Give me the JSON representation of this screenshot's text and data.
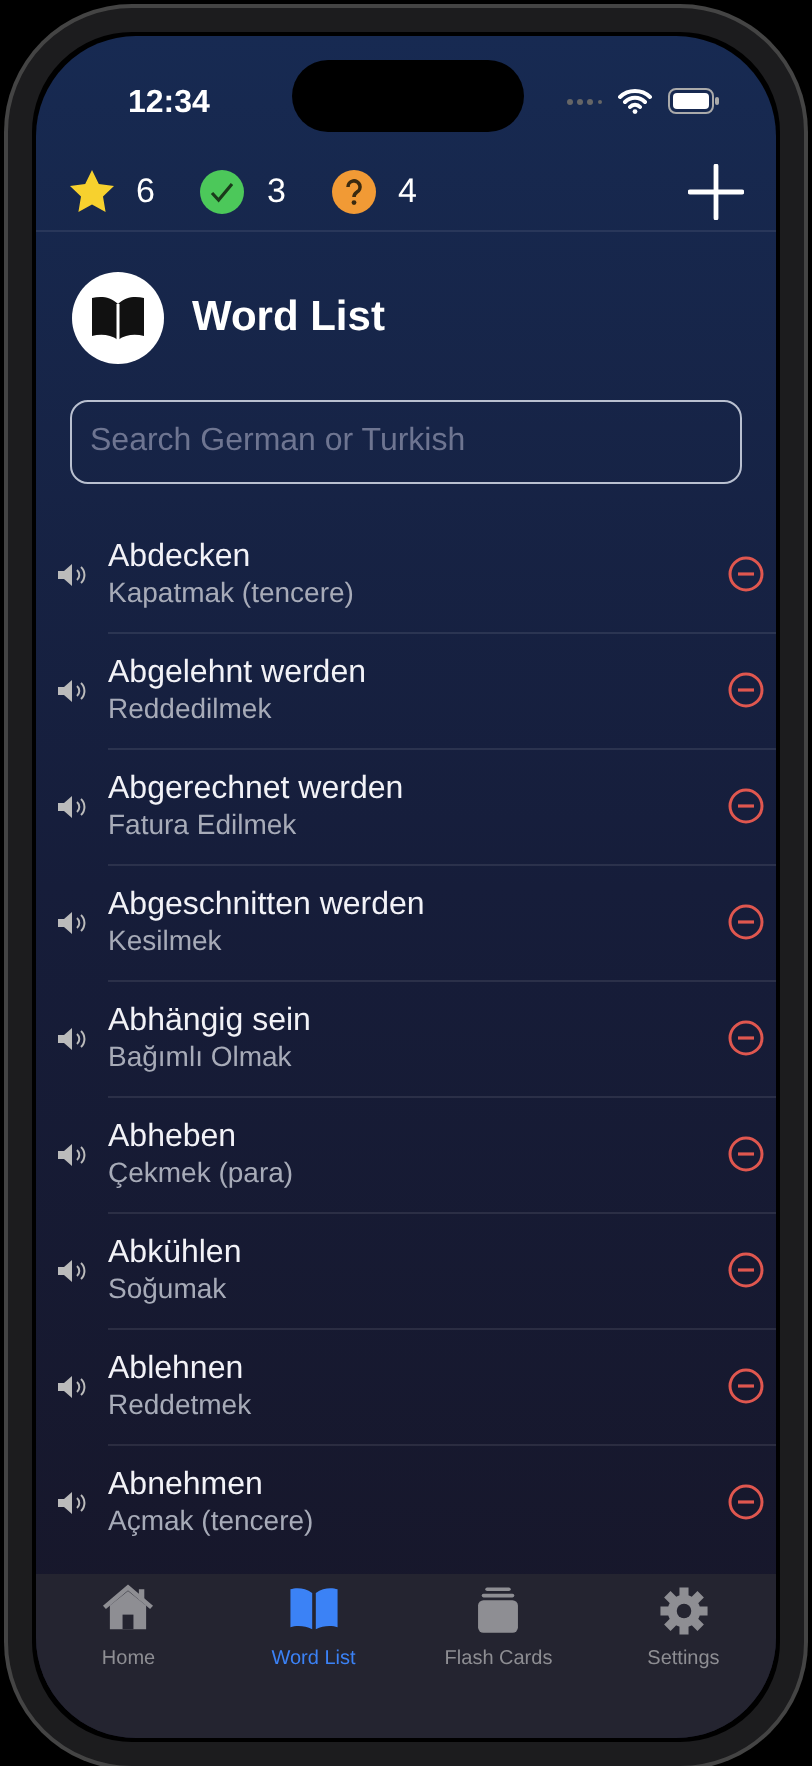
{
  "status_bar": {
    "time": "12:34"
  },
  "stats": [
    {
      "kind": "star",
      "count": "6"
    },
    {
      "kind": "check",
      "count": "3"
    },
    {
      "kind": "question",
      "count": "4"
    }
  ],
  "header": {
    "title": "Word List"
  },
  "search": {
    "placeholder": "Search German or Turkish"
  },
  "words": [
    {
      "german": "Abdecken",
      "turkish": "Kapatmak (tencere)"
    },
    {
      "german": "Abgelehnt werden",
      "turkish": "Reddedilmek"
    },
    {
      "german": "Abgerechnet werden",
      "turkish": "Fatura Edilmek"
    },
    {
      "german": "Abgeschnitten werden",
      "turkish": "Kesilmek"
    },
    {
      "german": "Abhängig sein",
      "turkish": "Bağımlı Olmak"
    },
    {
      "german": "Abheben",
      "turkish": "Çekmek (para)"
    },
    {
      "german": "Abkühlen",
      "turkish": "Soğumak"
    },
    {
      "german": "Ablehnen",
      "turkish": "Reddetmek"
    },
    {
      "german": "Abnehmen",
      "turkish": "Açmak (tencere)"
    }
  ],
  "tab_bar": [
    {
      "kind": "home",
      "label": "Home",
      "selected": false
    },
    {
      "kind": "book",
      "label": "Word List",
      "selected": true
    },
    {
      "kind": "cards",
      "label": "Flash Cards",
      "selected": false
    },
    {
      "kind": "gear",
      "label": "Settings",
      "selected": false
    }
  ]
}
